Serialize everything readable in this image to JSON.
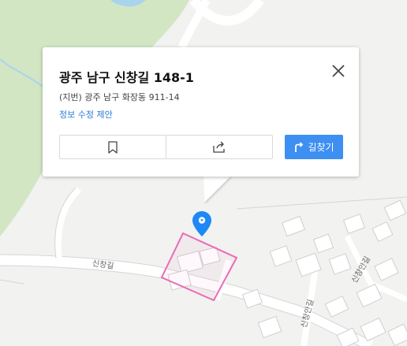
{
  "map": {
    "road_labels": {
      "main": "신창길",
      "side_lower": "신창안길",
      "side_right": "신창안길"
    }
  },
  "popup": {
    "title": "광주 남구 신창길 148-1",
    "lot_address": "(지번) 광주 남구 화장동 911-14",
    "edit_suggestion": "정보 수정 제안",
    "route_label": "길찾기"
  },
  "icons": {
    "close": "close-icon",
    "bookmark": "bookmark-icon",
    "share": "share-icon",
    "route": "route-icon",
    "marker": "map-pin-icon"
  },
  "colors": {
    "accent": "#3d8ff2",
    "link": "#2a79d6",
    "parcel_outline": "#e96bb5",
    "marker": "#1e88f5",
    "green_area": "#d2e6c4",
    "water": "#a9d4ee"
  }
}
